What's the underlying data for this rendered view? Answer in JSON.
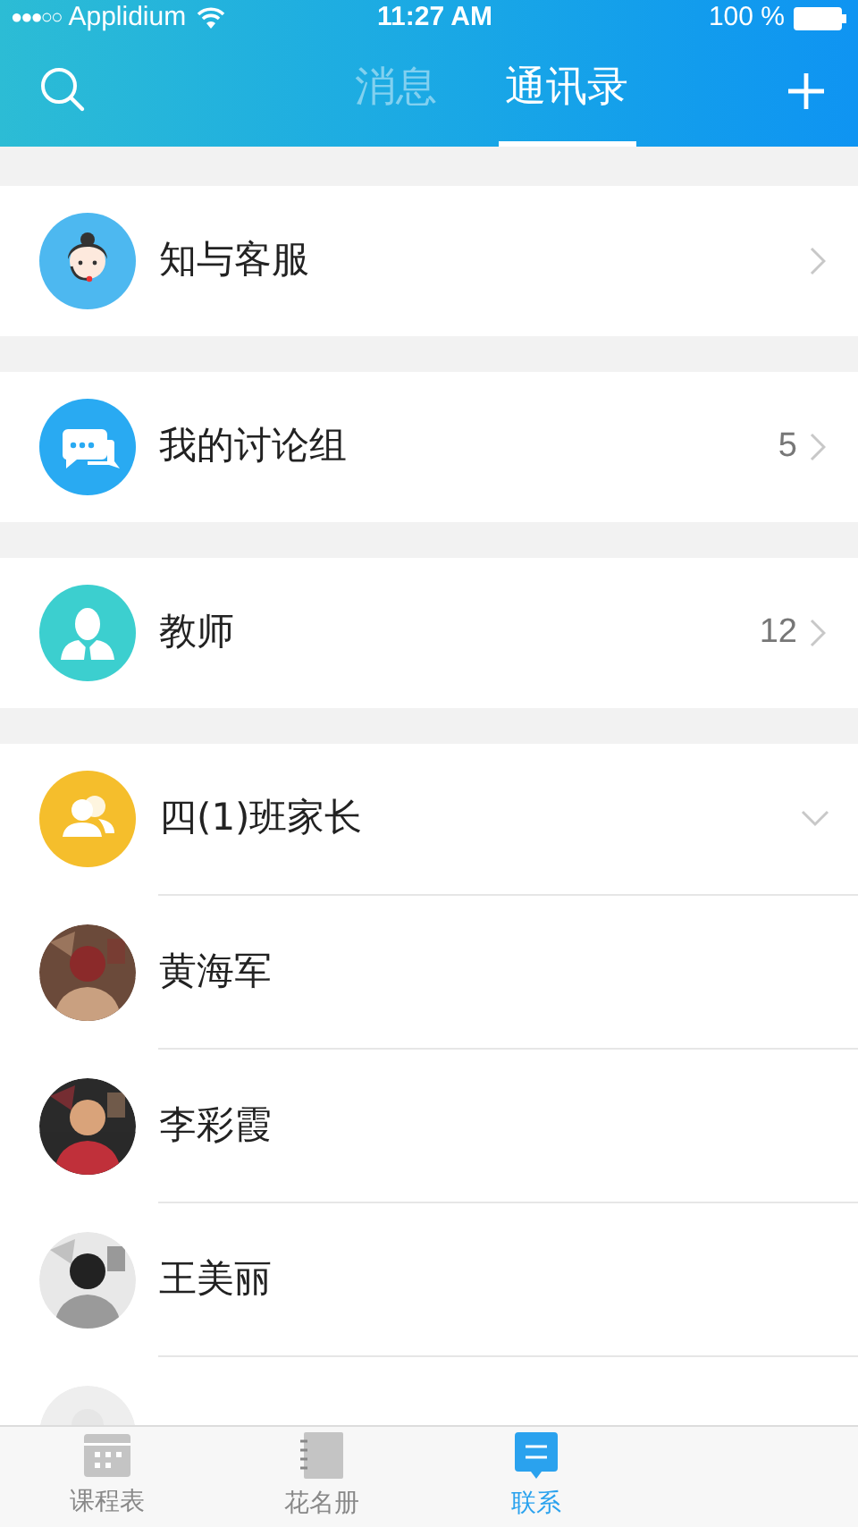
{
  "status_bar": {
    "signal": "●●●○○",
    "carrier": "Applidium",
    "time": "11:27 AM",
    "battery": "100 %"
  },
  "nav": {
    "tabs": [
      {
        "label": "消息",
        "selected": false
      },
      {
        "label": "通讯录",
        "selected": true
      }
    ]
  },
  "sections": [
    {
      "kind": "service",
      "name": "知与客服",
      "color": "#4db8f0"
    },
    {
      "kind": "group",
      "name": "我的讨论组",
      "count": "5",
      "color": "#29aaf2"
    },
    {
      "kind": "teacher",
      "name": "教师",
      "count": "12",
      "color": "#3ccfcf"
    }
  ],
  "class_group": {
    "name": "四(1)班家长",
    "expanded": true,
    "color": "#f5be2c",
    "members": [
      {
        "name": "黄海军",
        "kind": "picture"
      },
      {
        "name": "李彩霞",
        "kind": "picture"
      },
      {
        "name": "王美丽",
        "kind": "picture"
      },
      {
        "kind": "picture"
      }
    ]
  },
  "tab_bar": [
    {
      "kind": "calendar",
      "label": "课程表",
      "selected": false
    },
    {
      "kind": "notebook",
      "label": "花名册",
      "selected": false
    },
    {
      "kind": "chat",
      "label": "联系",
      "selected": true
    }
  ]
}
